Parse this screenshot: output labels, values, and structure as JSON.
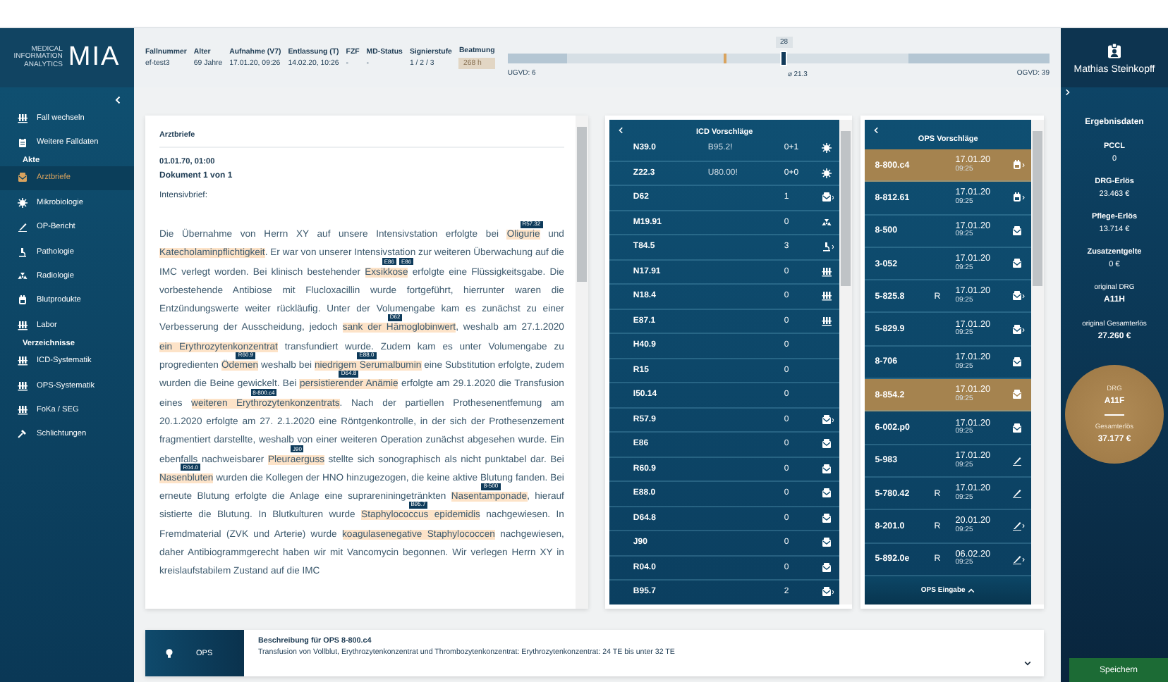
{
  "logo": {
    "tagline": [
      "MEDICAL",
      "INFORMATION",
      "ANALYTICS"
    ],
    "mark": "MIA"
  },
  "header": {
    "fields": [
      {
        "label": "Fallnummer",
        "value": "ef-test3",
        "kind": "plain"
      },
      {
        "label": "Alter",
        "value": "69 Jahre",
        "kind": "plain"
      },
      {
        "label": "Aufnahme (V7)",
        "value": "17.01.20, 09:26",
        "kind": "plain"
      },
      {
        "label": "Entlassung (T)",
        "value": "14.02.20, 10:26",
        "kind": "plain"
      },
      {
        "label": "FZF",
        "value": "-",
        "kind": "plain"
      },
      {
        "label": "MD-Status",
        "value": "-",
        "kind": "plain"
      },
      {
        "label": "Signierstufe",
        "value": "1 / 2 / 3",
        "kind": "plain"
      },
      {
        "label": "Beatmung",
        "value": "268 h",
        "kind": "badge"
      }
    ],
    "stay": {
      "level": 0.51,
      "value": "28",
      "min": "UGVD: 6",
      "mean": "⌀ 21.3",
      "max": "OGVD: 39"
    }
  },
  "user": {
    "name": "Mathias Steinkopff"
  },
  "sidebar": {
    "top_items": [
      {
        "label": "Fall wechseln",
        "kind": "rack",
        "selected": false
      },
      {
        "label": "Weitere Falldaten",
        "kind": "clipboard",
        "selected": false
      }
    ],
    "sections": [
      {
        "title": "Akte",
        "items": [
          {
            "label": "Arztbriefe",
            "kind": "letter",
            "selected": true
          },
          {
            "label": "Mikrobiologie",
            "kind": "germ",
            "selected": false
          },
          {
            "label": "OP-Bericht",
            "kind": "scalpel",
            "selected": false
          },
          {
            "label": "Pathologie",
            "kind": "microscope",
            "selected": false
          },
          {
            "label": "Radiologie",
            "kind": "radiation",
            "selected": false
          },
          {
            "label": "Blutprodukte",
            "kind": "blood",
            "selected": false
          },
          {
            "label": "Labor",
            "kind": "rack",
            "selected": false
          }
        ]
      },
      {
        "title": "Verzeichnisse",
        "items": [
          {
            "label": "ICD-Systematik",
            "kind": "rack",
            "selected": false
          },
          {
            "label": "OPS-Systematik",
            "kind": "rack",
            "selected": false
          },
          {
            "label": "FoKa / SEG",
            "kind": "rack",
            "selected": false
          },
          {
            "label": "Schlichtungen",
            "kind": "gavel",
            "selected": false
          }
        ]
      }
    ]
  },
  "document": {
    "section": "Arztbriefe",
    "date": "01.01.70, 01:00",
    "counter": "Dokument 1 von 1",
    "heading": "Intensivbrief:",
    "segments": [
      {
        "text": "Die Übernahme von Herrn XY auf unsere Intensivstation erfolgte bei ",
        "highlight": false
      },
      {
        "text": "Oligurie",
        "highlight": true,
        "codes": [
          "R57.32"
        ]
      },
      {
        "text": " und ",
        "highlight": false
      },
      {
        "text": "Katecholaminpflichtigkeit",
        "highlight": true
      },
      {
        "text": ". Er war von unserer Intensivstation zur weiteren Überwachung auf die IMC verlegt worden. Bei klinisch bestehender ",
        "highlight": false
      },
      {
        "text": "Exsikkose",
        "highlight": true,
        "codes": [
          "E86",
          "E86"
        ]
      },
      {
        "text": " erfolgte eine Flüssigkeitsgabe. Die vorbestehende Antibiose mit Flucloxacillin wurde fortgeführt, hierrunter waren die Entzündungswerte weiter rückläufig. Unter der Volumengabe kam es zunächst zu einer Verbesserung der Ausscheidung, jedoch ",
        "highlight": false
      },
      {
        "text": "sank der Hämoglobinwert",
        "highlight": true,
        "codes": [
          "D62"
        ]
      },
      {
        "text": ", weshalb am 27.1.2020 ",
        "highlight": false
      },
      {
        "text": "ein Erythrozytenkonzentrat",
        "highlight": true
      },
      {
        "text": " transfundiert wurde. Zudem kam es unter Volumengabe zu progredienten ",
        "highlight": false
      },
      {
        "text": "Ödemen",
        "highlight": true,
        "codes": [
          "R60.9"
        ]
      },
      {
        "text": " weshalb bei ",
        "highlight": false
      },
      {
        "text": "niedrigem Serumalbumin",
        "highlight": true,
        "codes": [
          "E88.0"
        ]
      },
      {
        "text": " eine Substitution erfolgte, zudem wurden die Beine gewickelt. Bei ",
        "highlight": false
      },
      {
        "text": "persistierender Anämie",
        "highlight": true,
        "codes": [
          "D64.8"
        ]
      },
      {
        "text": " erfolgte am 29.1.2020 die Transfusion eines ",
        "highlight": false
      },
      {
        "text": "weiteren Erythrozytenkonzentrats",
        "highlight": true,
        "codes": [
          "8-800.c4"
        ]
      },
      {
        "text": ". Nach der partiellen Prothesenentfemung am 20.1.2020 erfolgte am 27. 2.1.2020 eine Röntgenkontrolle, in der sich der Prothesenzement fragmentiert darstellte, weshalb von einer weiteren Operation zunächst abgesehen wurde. Ein ebenfalls nachweisbarer ",
        "highlight": false
      },
      {
        "text": "Pleuraerguss",
        "highlight": true,
        "codes": [
          "J90"
        ]
      },
      {
        "text": " stellte sich sonographisch als nicht punktabel dar. Bei ",
        "highlight": false
      },
      {
        "text": "Nasenbluten",
        "highlight": true,
        "codes": [
          "R04.0"
        ]
      },
      {
        "text": " wurden die Kollegen der HNO hinzugezogen, die keine aktive Blutung fanden. Bei erneute Blutung erfolgte die Anlage eine suprareniningetränkten ",
        "highlight": false
      },
      {
        "text": "Nasentamponade",
        "highlight": true,
        "codes": [
          "8-500"
        ]
      },
      {
        "text": ", hierauf sistierte die Blutung. In Blutkulturen wurde ",
        "highlight": false
      },
      {
        "text": "Staphylococcus epidemidis",
        "highlight": true,
        "codes": [
          "B95.7"
        ]
      },
      {
        "text": " nachgewiesen. In Fremdmaterial (ZVK und Arterie) wurde ",
        "highlight": false
      },
      {
        "text": "koagulasenegative Staphylococcen",
        "highlight": true
      },
      {
        "text": " nachgewiesen, daher Antibiogrammgerecht haben wir mit Vancomycin begonnen. Wir verlegen Herrn XY in kreislaufstabilem Zustand auf die IMC",
        "highlight": false
      }
    ]
  },
  "icd": {
    "title": "ICD Vorschläge",
    "rows": [
      {
        "code": "N39.0",
        "secondary": "B95.2!",
        "count": "0+1",
        "kind": "germ",
        "more": false
      },
      {
        "code": "Z22.3",
        "secondary": "U80.00!",
        "count": "0+0",
        "kind": "germ",
        "more": false
      },
      {
        "code": "D62",
        "count": "1",
        "kind": "letter",
        "more": true
      },
      {
        "code": "M19.91",
        "count": "0",
        "kind": "radiation",
        "more": false
      },
      {
        "code": "T84.5",
        "count": "3",
        "kind": "microscope",
        "more": true
      },
      {
        "code": "N17.91",
        "count": "0",
        "kind": "rack",
        "more": false
      },
      {
        "code": "N18.4",
        "count": "0",
        "kind": "rack",
        "more": false
      },
      {
        "code": "E87.1",
        "count": "0",
        "kind": "rack",
        "more": false
      },
      {
        "code": "H40.9",
        "count": "0",
        "kind": "none"
      },
      {
        "code": "R15",
        "count": "0",
        "kind": "none"
      },
      {
        "code": "I50.14",
        "count": "0",
        "kind": "none"
      },
      {
        "code": "R57.9",
        "count": "0",
        "kind": "letter",
        "more": true
      },
      {
        "code": "E86",
        "count": "0",
        "kind": "letter",
        "more": false
      },
      {
        "code": "R60.9",
        "count": "0",
        "kind": "letter",
        "more": false
      },
      {
        "code": "E88.0",
        "count": "0",
        "kind": "letter",
        "more": false
      },
      {
        "code": "D64.8",
        "count": "0",
        "kind": "letter",
        "more": false
      },
      {
        "code": "J90",
        "count": "0",
        "kind": "letter",
        "more": false
      },
      {
        "code": "R04.0",
        "count": "0",
        "kind": "letter",
        "more": false
      },
      {
        "code": "B95.7",
        "count": "2",
        "kind": "letter",
        "more": true
      }
    ]
  },
  "ops": {
    "title": "OPS Vorschläge",
    "footer": "OPS Eingabe",
    "rows": [
      {
        "code": "8-800.c4",
        "date": "17.01.20",
        "time": "09:25",
        "kind": "blood",
        "more": true,
        "selected": true
      },
      {
        "code": "8-812.61",
        "date": "17.01.20",
        "time": "09:25",
        "kind": "blood",
        "more": true,
        "selected": false
      },
      {
        "code": "8-500",
        "date": "17.01.20",
        "time": "09:25",
        "kind": "letter",
        "more": false,
        "selected": false
      },
      {
        "code": "3-052",
        "date": "17.01.20",
        "time": "09:25",
        "kind": "letter",
        "more": false,
        "selected": false
      },
      {
        "code": "5-825.8",
        "flag": "R",
        "date": "17.01.20",
        "time": "09:25",
        "kind": "letter",
        "more": true,
        "selected": false
      },
      {
        "code": "5-829.9",
        "date": "17.01.20",
        "time": "09:25",
        "kind": "letter",
        "more": true,
        "selected": false
      },
      {
        "code": "8-706",
        "date": "17.01.20",
        "time": "09:25",
        "kind": "letter",
        "more": false,
        "selected": false
      },
      {
        "code": "8-854.2",
        "date": "17.01.20",
        "time": "09:25",
        "kind": "letter",
        "more": false,
        "selected": true
      },
      {
        "code": "6-002.p0",
        "date": "17.01.20",
        "time": "09:25",
        "kind": "letter",
        "more": false,
        "selected": false
      },
      {
        "code": "5-983",
        "date": "17.01.20",
        "time": "09:25",
        "kind": "scalpel",
        "more": false,
        "selected": false
      },
      {
        "code": "5-780.42",
        "flag": "R",
        "date": "17.01.20",
        "time": "09:25",
        "kind": "scalpel",
        "more": false,
        "selected": false
      },
      {
        "code": "8-201.0",
        "flag": "R",
        "date": "20.01.20",
        "time": "09:25",
        "kind": "scalpel",
        "more": true,
        "selected": false
      },
      {
        "code": "5-892.0e",
        "flag": "R",
        "date": "06.02.20",
        "time": "09:25",
        "kind": "scalpel",
        "more": true,
        "selected": false
      }
    ]
  },
  "results": {
    "title": "Ergebnisdaten",
    "items": [
      {
        "label": "PCCL",
        "value": "0"
      },
      {
        "label": "DRG-Erlös",
        "value": "23.463 €"
      },
      {
        "label": "Pflege-Erlös",
        "value": "13.714 €"
      },
      {
        "label": "Zusatzentgelte",
        "value": "0 €"
      }
    ],
    "original": [
      {
        "label": "original DRG",
        "value": "A11H"
      },
      {
        "label": "original Gesamterlös",
        "value": "27.260 €"
      }
    ],
    "result": {
      "drg_label": "DRG",
      "drg": "A11F",
      "total_label": "Gesamterlös",
      "total": "37.177 €"
    },
    "save": "Speichern"
  },
  "description": {
    "tab": "OPS",
    "title": "Beschreibung für OPS 8-800.c4",
    "text": "Transfusion von Vollblut, Erythrozytenkonzentrat und Thrombozytenkonzentrat: Erythrozytenkonzentrat: 24 TE bis unter 32 TE"
  }
}
